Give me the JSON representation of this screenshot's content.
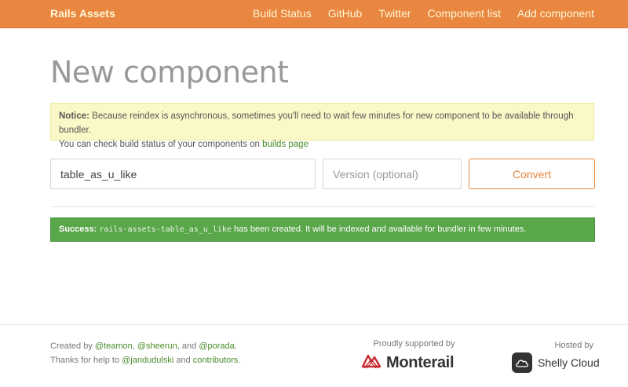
{
  "navbar": {
    "brand": "Rails Assets",
    "links": [
      "Build Status",
      "GitHub",
      "Twitter",
      "Component list",
      "Add component"
    ]
  },
  "page": {
    "title": "New component"
  },
  "notice": {
    "label": "Notice:",
    "text1": " Because reindex is asynchronous, sometimes you'll need to wait few minutes for new component to be available through bundler.",
    "text2": "You can check build status of your components on ",
    "link": "builds page"
  },
  "form": {
    "name_value": "table_as_u_like",
    "version_placeholder": "Version (optional)",
    "convert_label": "Convert"
  },
  "success": {
    "label": "Success:",
    "gem": "rails-assets-table_as_u_like",
    "text": " has been created. It will be indexed and available for bundler in few minutes."
  },
  "footer": {
    "created_by": "Created by ",
    "author1": "@teamon",
    "sep1": ", ",
    "author2": "@sheerun",
    "sep2": ", and ",
    "author3": "@porada",
    "end1": ".",
    "thanks": "Thanks for help to ",
    "helper": "@jandudulski",
    "and": " and ",
    "contributors": "contributors",
    "end2": ".",
    "supported_by": "Proudly supported by",
    "sponsor": "Monterail",
    "hosted_by": "Hosted by",
    "host": "Shelly Cloud"
  },
  "colors": {
    "brand_orange": "#e9863f",
    "success_green": "#5aa64a",
    "notice_yellow": "#fbf8c8",
    "link_green": "#4a8c2a"
  },
  "icons": [
    "monterail-logo-icon",
    "shelly-cloud-icon"
  ]
}
